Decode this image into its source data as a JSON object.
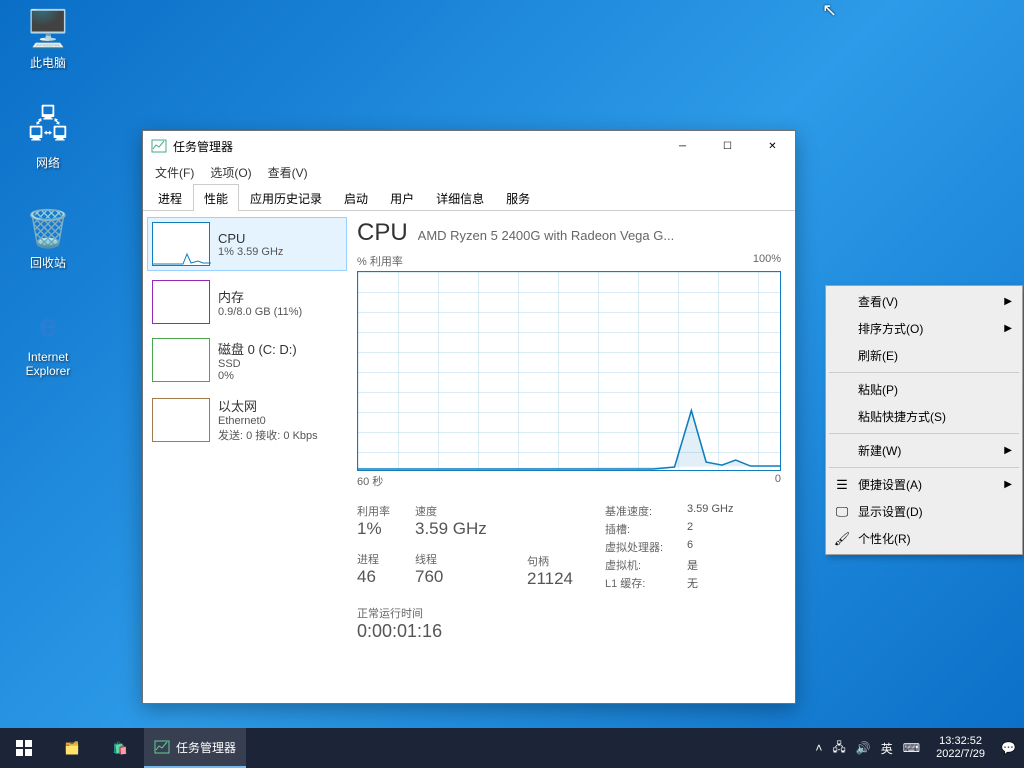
{
  "desktop_icons": {
    "this_pc": "此电脑",
    "network": "网络",
    "recycle": "回收站",
    "ie_top": "Internet",
    "ie_bottom": "Explorer"
  },
  "window": {
    "title": "任务管理器",
    "menu": {
      "file": "文件(F)",
      "options": "选项(O)",
      "view": "查看(V)"
    },
    "tabs": {
      "processes": "进程",
      "performance": "性能",
      "apphistory": "应用历史记录",
      "startup": "启动",
      "users": "用户",
      "details": "详细信息",
      "services": "服务"
    }
  },
  "side": {
    "cpu": {
      "name": "CPU",
      "sub": "1% 3.59 GHz"
    },
    "mem": {
      "name": "内存",
      "sub": "0.9/8.0 GB (11%)"
    },
    "disk": {
      "name": "磁盘 0 (C: D:)",
      "sub1": "SSD",
      "sub2": "0%"
    },
    "eth": {
      "name": "以太网",
      "sub1": "Ethernet0",
      "sub2": "发送: 0 接收: 0 Kbps"
    }
  },
  "main": {
    "heading": "CPU",
    "model": "AMD Ryzen 5 2400G with Radeon Vega G...",
    "tl": "% 利用率",
    "tr": "100%",
    "bl": "60 秒",
    "br": "0",
    "stats": {
      "util_l": "利用率",
      "util_v": "1%",
      "speed_l": "速度",
      "speed_v": "3.59 GHz",
      "proc_l": "进程",
      "proc_v": "46",
      "threads_l": "线程",
      "threads_v": "760",
      "handles_l": "句柄",
      "handles_v": "21124"
    },
    "kv": {
      "base_l": "基准速度:",
      "base_v": "3.59 GHz",
      "sock_l": "插槽:",
      "sock_v": "2",
      "logi_l": "虚拟处理器:",
      "logi_v": "6",
      "virt_l": "虚拟机:",
      "virt_v": "是",
      "l1_l": "L1 缓存:",
      "l1_v": "无"
    },
    "uptime_l": "正常运行时间",
    "uptime_v": "0:00:01:16"
  },
  "ctx": {
    "view": "查看(V)",
    "sort": "排序方式(O)",
    "refresh": "刷新(E)",
    "paste": "粘贴(P)",
    "paste_sc": "粘贴快捷方式(S)",
    "new": "新建(W)",
    "easy": "便捷设置(A)",
    "display": "显示设置(D)",
    "personal": "个性化(R)"
  },
  "taskbar": {
    "app": "任务管理器",
    "ime": "英",
    "time": "13:32:52",
    "date": "2022/7/29"
  },
  "chart_data": {
    "type": "line",
    "title": "CPU % 利用率",
    "xlabel": "60 秒 → 0",
    "ylabel": "% 利用率",
    "ylim": [
      0,
      100
    ],
    "x": [
      0,
      5,
      10,
      15,
      20,
      25,
      30,
      35,
      40,
      45,
      48,
      50,
      52,
      54,
      56,
      58,
      60
    ],
    "values": [
      0,
      0,
      0,
      0,
      0,
      0,
      0,
      0,
      0,
      0,
      2,
      30,
      6,
      3,
      5,
      3,
      2
    ]
  }
}
